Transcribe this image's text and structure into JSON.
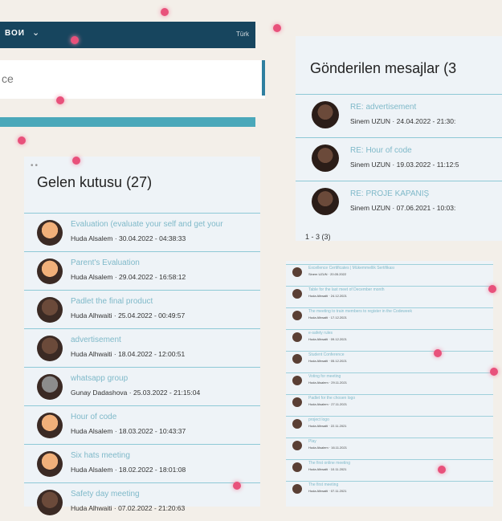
{
  "header": {
    "brand": "ВОИ",
    "lang": "Türk",
    "search_placeholder": "ce"
  },
  "inbox": {
    "title": "Gelen kutusu (27)",
    "items": [
      {
        "subject": "Evaluation (evaluate your self and get your",
        "sender": "Huda Alsalem",
        "date": "30.04.2022 - 04:38:33",
        "avatar": "#f1b07a"
      },
      {
        "subject": "Parent's Evaluation",
        "sender": "Huda Alsalem",
        "date": "29.04.2022 - 16:58:12",
        "avatar": "#f1b07a"
      },
      {
        "subject": "Padlet the final product",
        "sender": "Huda Alhwaiti",
        "date": "25.04.2022 - 00:49:57",
        "avatar": "#6b4a3a"
      },
      {
        "subject": "advertisement",
        "sender": "Huda Alhwaiti",
        "date": "18.04.2022 - 12:00:51",
        "avatar": "#6b4a3a"
      },
      {
        "subject": "whatsapp group",
        "sender": "Gunay Dadashova",
        "date": "25.03.2022 - 21:15:04",
        "avatar": "#8c8c8c"
      },
      {
        "subject": "Hour of code",
        "sender": "Huda Alsalem",
        "date": "18.03.2022 - 10:43:37",
        "avatar": "#f1b07a"
      },
      {
        "subject": "Six hats meeting",
        "sender": "Huda Alsalem",
        "date": "18.02.2022 - 18:01:08",
        "avatar": "#f1b07a"
      },
      {
        "subject": "Safety day meeting",
        "sender": "Huda Alhwaiti",
        "date": "07.02.2022 - 21:20:63",
        "avatar": "#6b4a3a"
      }
    ]
  },
  "sent": {
    "title": "Gönderilen mesajlar (3",
    "items": [
      {
        "subject": "RE: advertisement",
        "sender": "Sinem UZUN",
        "date": "24.04.2022 - 21:30:"
      },
      {
        "subject": "RE: Hour of code",
        "sender": "Sinem UZUN",
        "date": "19.03.2022 - 11:12:5"
      },
      {
        "subject": "RE: PROJE KAPANIŞ",
        "sender": "Sinem UZUN",
        "date": "07.06.2021 - 10:03:"
      }
    ],
    "pager": "1 - 3 (3)"
  },
  "mini": {
    "items": [
      {
        "subject": "Excellence Certificates | Mükemmellik Sertifikası",
        "meta": "Sinem UZUN · 20.05.2022"
      },
      {
        "subject": "Table for the last meet of December month",
        "meta": "Huda Alhwaiti · 24.12.2021"
      },
      {
        "subject": "The meeting to train members to register in the Codeweek",
        "meta": "Huda Alhwaiti · 17.12.2021"
      },
      {
        "subject": "e-safety rules",
        "meta": "Huda Alhwaiti · 09.12.2021"
      },
      {
        "subject": "Student Conference",
        "meta": "Huda Alhwaiti · 05.12.2021"
      },
      {
        "subject": "Voting for meeting",
        "meta": "Huda Alsalem · 29.11.2021"
      },
      {
        "subject": "Padlet for the chosen logo",
        "meta": "Huda Alsalem · 27.11.2021"
      },
      {
        "subject": "project logo",
        "meta": "Huda Alhwaiti · 22.11.2021"
      },
      {
        "subject": "Play",
        "meta": "Huda Alsalem · 16.11.2021"
      },
      {
        "subject": "The first online meeting",
        "meta": "Huda Alhwaiti · 10.11.2021"
      },
      {
        "subject": "The first  meeting",
        "meta": "Huda Alhwaiti · 07.11.2021"
      }
    ]
  }
}
